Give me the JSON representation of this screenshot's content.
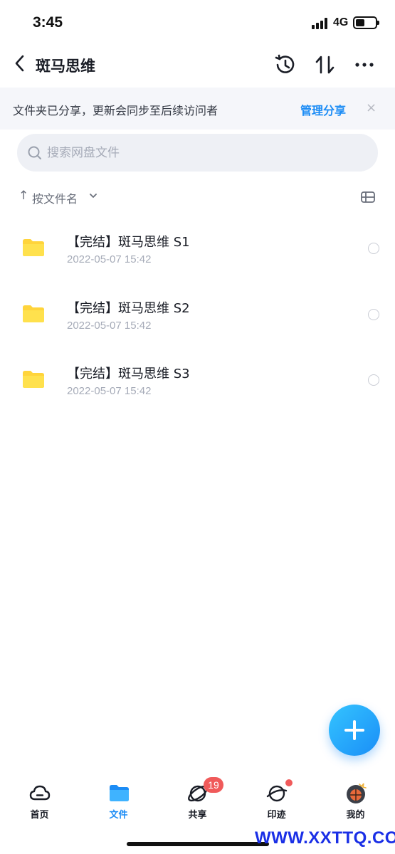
{
  "status_bar": {
    "time": "3:45",
    "network": "4G",
    "battery_level": 0.45
  },
  "nav": {
    "title": "斑马思维",
    "back_icon": "chevron-left-icon",
    "history_icon": "history-icon",
    "sort_icon": "sort-arrows-icon",
    "more_icon": "more-dots-icon"
  },
  "share_banner": {
    "text": "文件夹已分享，更新会同步至后续访问者",
    "action": "管理分享",
    "close": "×"
  },
  "search": {
    "placeholder": "搜索网盘文件"
  },
  "sort": {
    "arrow": "↑",
    "label": "按文件名"
  },
  "files": [
    {
      "name": "【完结】斑马思维 S1",
      "date": "2022-05-07 15:42"
    },
    {
      "name": "【完结】斑马思维 S2",
      "date": "2022-05-07 15:42"
    },
    {
      "name": "【完结】斑马思维 S3",
      "date": "2022-05-07 15:42"
    }
  ],
  "tabs": [
    {
      "label": "首页",
      "icon": "cloud-icon"
    },
    {
      "label": "文件",
      "icon": "folder-icon",
      "active": true
    },
    {
      "label": "共享",
      "icon": "orbit-icon",
      "badge": "19"
    },
    {
      "label": "印迹",
      "icon": "planet-icon",
      "dot": true
    },
    {
      "label": "我的",
      "icon": "avatar-icon"
    }
  ],
  "watermark": "WWW.XXTTQ.COM",
  "colors": {
    "accent": "#1c8cf5",
    "folder": "#ffd43b",
    "badge": "#f05a5a",
    "banner_bg": "#f5f6fa"
  }
}
